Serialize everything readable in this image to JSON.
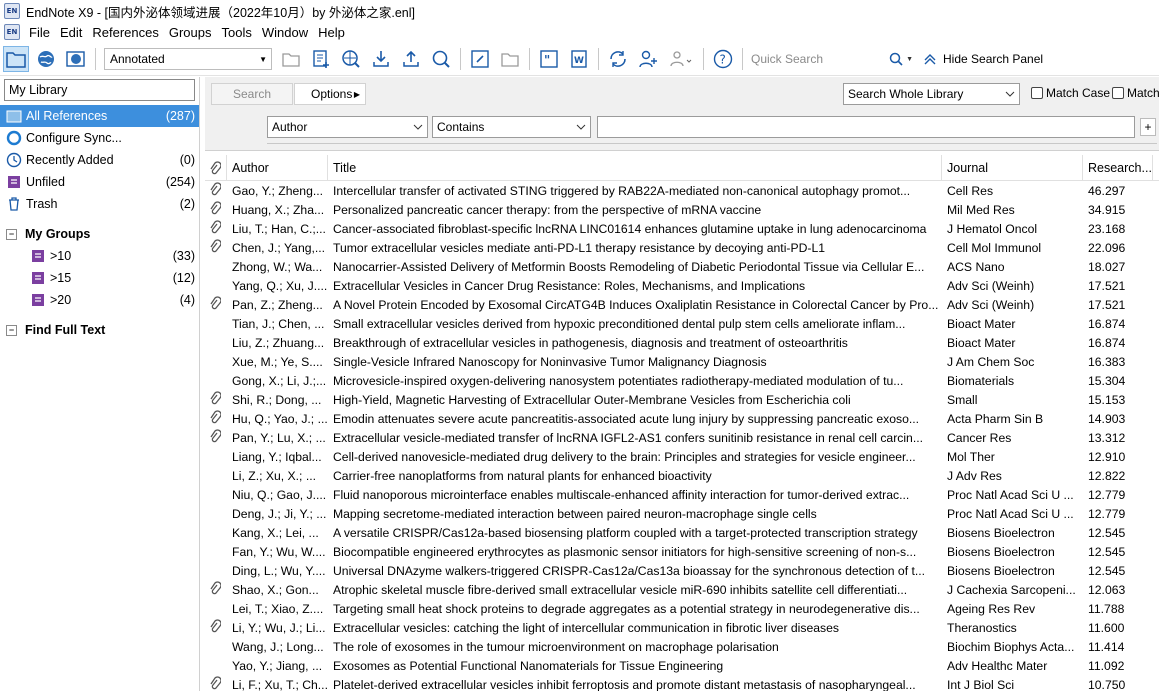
{
  "window": {
    "title": "EndNote X9 - [国内外泌体领域进展（2022年10月）by 外泌体之家.enl]",
    "app_icon": "EN"
  },
  "menu": [
    "File",
    "Edit",
    "References",
    "Groups",
    "Tools",
    "Window",
    "Help"
  ],
  "toolbar": {
    "style_value": "Annotated",
    "quick_search_placeholder": "Quick Search",
    "hide_search_panel": "Hide Search Panel"
  },
  "sidebar": {
    "library_select": "My Library",
    "items": [
      {
        "label": "All References",
        "count": "(287)",
        "icon": "library-icon"
      },
      {
        "label": "Configure Sync...",
        "count": "",
        "icon": "sync-icon"
      },
      {
        "label": "Recently Added",
        "count": "(0)",
        "icon": "clock-icon"
      },
      {
        "label": "Unfiled",
        "count": "(254)",
        "icon": "unfiled-icon"
      },
      {
        "label": "Trash",
        "count": "(2)",
        "icon": "trash-icon"
      }
    ],
    "my_groups": "My Groups",
    "groups": [
      {
        "label": ">10",
        "count": "(33)"
      },
      {
        "label": ">15",
        "count": "(12)"
      },
      {
        "label": ">20",
        "count": "(4)"
      }
    ],
    "find_full_text": "Find Full Text"
  },
  "search_panel": {
    "search_button": "Search",
    "options_button": "Options",
    "scope_value": "Search Whole Library",
    "match_case": "Match Case",
    "match_words": "Match",
    "field_value": "Author",
    "operator_value": "Contains",
    "add_button": "+"
  },
  "columns": {
    "author": "Author",
    "title": "Title",
    "journal": "Journal",
    "research": "Research..."
  },
  "references": [
    {
      "att": true,
      "author": "Gao, Y.; Zheng...",
      "title": "Intercellular transfer of activated STING triggered by RAB22A-mediated non-canonical autophagy promot...",
      "journal": "Cell Res",
      "research": "46.297"
    },
    {
      "att": true,
      "author": "Huang, X.; Zha...",
      "title": "Personalized pancreatic cancer therapy: from the perspective of mRNA vaccine",
      "journal": "Mil Med Res",
      "research": "34.915"
    },
    {
      "att": true,
      "author": "Liu, T.; Han, C.;...",
      "title": "Cancer-associated fibroblast-specific lncRNA LINC01614 enhances glutamine uptake in lung adenocarcinoma",
      "journal": "J Hematol Oncol",
      "research": "23.168"
    },
    {
      "att": true,
      "author": "Chen, J.; Yang,...",
      "title": "Tumor extracellular vesicles mediate anti-PD-L1 therapy resistance by decoying anti-PD-L1",
      "journal": "Cell Mol Immunol",
      "research": "22.096"
    },
    {
      "att": false,
      "author": "Zhong, W.; Wa...",
      "title": "Nanocarrier-Assisted Delivery of Metformin Boosts Remodeling of Diabetic Periodontal Tissue via Cellular E...",
      "journal": "ACS Nano",
      "research": "18.027"
    },
    {
      "att": false,
      "author": "Yang, Q.; Xu, J....",
      "title": "Extracellular Vesicles in Cancer Drug Resistance: Roles, Mechanisms, and Implications",
      "journal": "Adv Sci (Weinh)",
      "research": "17.521"
    },
    {
      "att": true,
      "author": "Pan, Z.; Zheng...",
      "title": "A Novel Protein Encoded by Exosomal CircATG4B Induces Oxaliplatin Resistance in Colorectal Cancer by Pro...",
      "journal": "Adv Sci (Weinh)",
      "research": "17.521"
    },
    {
      "att": false,
      "author": "Tian, J.; Chen, ...",
      "title": "Small extracellular vesicles derived from hypoxic preconditioned dental pulp stem cells ameliorate inflam...",
      "journal": "Bioact Mater",
      "research": "16.874"
    },
    {
      "att": false,
      "author": "Liu, Z.; Zhuang...",
      "title": "Breakthrough of extracellular vesicles in pathogenesis, diagnosis and treatment of osteoarthritis",
      "journal": "Bioact Mater",
      "research": "16.874"
    },
    {
      "att": false,
      "author": "Xue, M.; Ye, S....",
      "title": "Single-Vesicle Infrared Nanoscopy for Noninvasive Tumor Malignancy Diagnosis",
      "journal": "J Am Chem Soc",
      "research": "16.383"
    },
    {
      "att": false,
      "author": "Gong, X.; Li, J.;...",
      "title": "Microvesicle-inspired oxygen-delivering nanosystem potentiates radiotherapy-mediated modulation of tu...",
      "journal": "Biomaterials",
      "research": "15.304"
    },
    {
      "att": true,
      "author": "Shi, R.; Dong, ...",
      "title": "High-Yield, Magnetic Harvesting of Extracellular Outer-Membrane Vesicles from Escherichia coli",
      "journal": "Small",
      "research": "15.153"
    },
    {
      "att": true,
      "author": "Hu, Q.; Yao, J.; ...",
      "title": "Emodin attenuates severe acute pancreatitis-associated acute lung injury by suppressing pancreatic exoso...",
      "journal": "Acta Pharm Sin B",
      "research": "14.903"
    },
    {
      "att": true,
      "author": "Pan, Y.; Lu, X.; ...",
      "title": "Extracellular vesicle-mediated transfer of lncRNA IGFL2-AS1 confers sunitinib resistance in renal cell carcin...",
      "journal": "Cancer Res",
      "research": "13.312"
    },
    {
      "att": false,
      "author": "Liang, Y.; Iqbal...",
      "title": "Cell-derived nanovesicle-mediated drug delivery to the brain: Principles and strategies for vesicle engineer...",
      "journal": "Mol Ther",
      "research": "12.910"
    },
    {
      "att": false,
      "author": "Li, Z.; Xu, X.; ...",
      "title": "Carrier-free nanoplatforms from natural plants for enhanced bioactivity",
      "journal": "J Adv Res",
      "research": "12.822"
    },
    {
      "att": false,
      "author": "Niu, Q.; Gao, J....",
      "title": "Fluid nanoporous microinterface enables multiscale-enhanced affinity interaction for tumor-derived extrac...",
      "journal": "Proc Natl Acad Sci U ...",
      "research": "12.779"
    },
    {
      "att": false,
      "author": "Deng, J.; Ji, Y.; ...",
      "title": "Mapping secretome-mediated interaction between paired neuron-macrophage single cells",
      "journal": "Proc Natl Acad Sci U ...",
      "research": "12.779"
    },
    {
      "att": false,
      "author": "Kang, X.; Lei, ...",
      "title": "A versatile CRISPR/Cas12a-based biosensing platform coupled with a target-protected transcription strategy",
      "journal": "Biosens Bioelectron",
      "research": "12.545"
    },
    {
      "att": false,
      "author": "Fan, Y.; Wu, W....",
      "title": "Biocompatible engineered erythrocytes as plasmonic sensor initiators for high-sensitive screening of non-s...",
      "journal": "Biosens Bioelectron",
      "research": "12.545"
    },
    {
      "att": false,
      "author": "Ding, L.; Wu, Y....",
      "title": "Universal DNAzyme walkers-triggered CRISPR-Cas12a/Cas13a bioassay for the synchronous detection of t...",
      "journal": "Biosens Bioelectron",
      "research": "12.545"
    },
    {
      "att": true,
      "author": "Shao, X.; Gon...",
      "title": "Atrophic skeletal muscle fibre-derived small extracellular vesicle miR-690 inhibits satellite cell differentiati...",
      "journal": "J Cachexia Sarcopeni...",
      "research": "12.063"
    },
    {
      "att": false,
      "author": "Lei, T.; Xiao, Z....",
      "title": "Targeting small heat shock proteins to degrade aggregates as a potential strategy in neurodegenerative dis...",
      "journal": "Ageing Res Rev",
      "research": "11.788"
    },
    {
      "att": true,
      "author": "Li, Y.; Wu, J.; Li...",
      "title": "Extracellular vesicles: catching the light of intercellular communication in fibrotic liver diseases",
      "journal": "Theranostics",
      "research": "11.600"
    },
    {
      "att": false,
      "author": "Wang, J.; Long...",
      "title": "The role of exosomes in the tumour microenvironment on macrophage polarisation",
      "journal": "Biochim Biophys Acta...",
      "research": "11.414"
    },
    {
      "att": false,
      "author": "Yao, Y.; Jiang, ...",
      "title": "Exosomes as Potential Functional Nanomaterials for Tissue Engineering",
      "journal": "Adv Healthc Mater",
      "research": "11.092"
    },
    {
      "att": true,
      "author": "Li, F.; Xu, T.; Ch...",
      "title": "Platelet-derived extracellular vesicles inhibit ferroptosis and promote distant metastasis of nasopharyngeal...",
      "journal": "Int J Biol Sci",
      "research": "10.750"
    }
  ]
}
